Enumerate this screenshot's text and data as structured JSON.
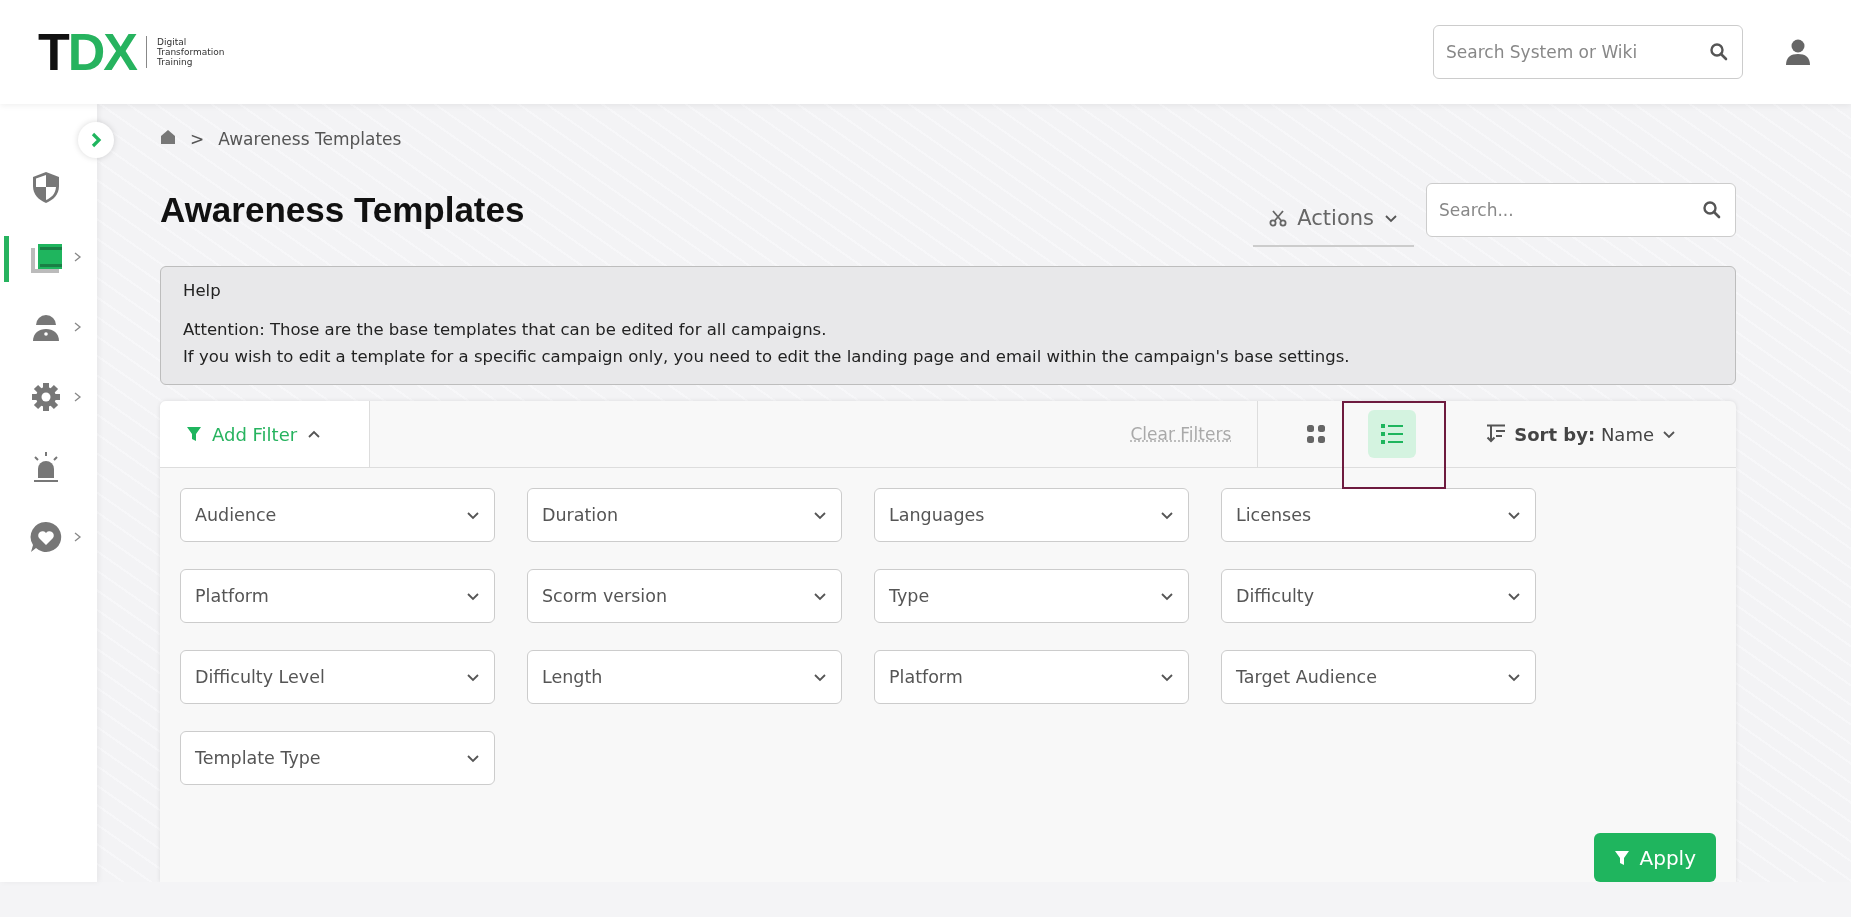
{
  "header": {
    "logo_parts": [
      {
        "text": "T",
        "color": "#111111"
      },
      {
        "text": "DX",
        "color": "#27b35f"
      }
    ],
    "tagline": [
      "Digital",
      "Transformation",
      "Training"
    ],
    "search": {
      "placeholder": "Search System or Wiki"
    }
  },
  "sidebar": {
    "items": [
      {
        "kind": "shield",
        "selected": false,
        "has_submenu": false
      },
      {
        "kind": "book",
        "selected": true,
        "has_submenu": true
      },
      {
        "kind": "person",
        "selected": false,
        "has_submenu": true
      },
      {
        "kind": "gear",
        "selected": false,
        "has_submenu": true
      },
      {
        "kind": "alarm",
        "selected": false,
        "has_submenu": false
      },
      {
        "kind": "heart",
        "selected": false,
        "has_submenu": true
      }
    ]
  },
  "breadcrumb": {
    "separator": ">",
    "current": "Awareness Templates"
  },
  "page": {
    "title": "Awareness Templates",
    "actions": "Actions",
    "search": {
      "placeholder": "Search..."
    }
  },
  "help": {
    "title": "Help",
    "lines": [
      "Attention: Those are the base templates that can be edited for all campaigns.",
      "If you wish to edit a template for a specific campaign only, you need to edit the landing page and email within the campaign's base settings."
    ]
  },
  "filter_bar": {
    "add_filter": "Add Filter",
    "expanded": true,
    "clear_filters": "Clear Filters",
    "clear_disabled": true,
    "views": [
      {
        "kind": "grid",
        "selected": false
      },
      {
        "kind": "list",
        "selected": true,
        "highlighted": true
      }
    ],
    "sort_label": "Sort by",
    "sort_separator": ":",
    "sort_value": "Name"
  },
  "filters": [
    "Audience",
    "Duration",
    "Languages",
    "Licenses",
    "Platform",
    "Scorm version",
    "Type",
    "Difficulty",
    "Difficulty Level",
    "Length",
    "Platform",
    "Target Audience",
    "Template Type"
  ],
  "apply": "Apply"
}
